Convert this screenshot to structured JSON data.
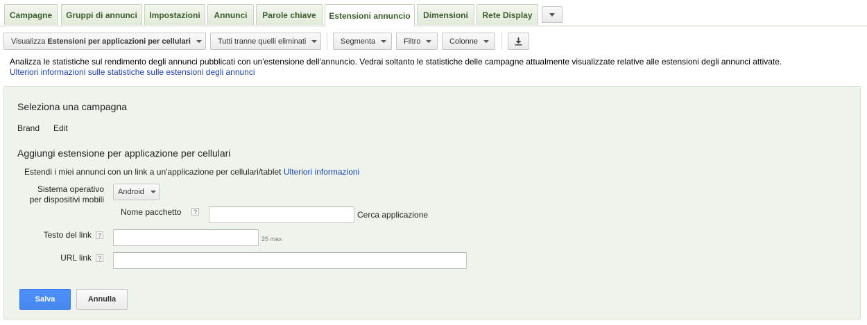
{
  "tabs": [
    {
      "label": "Campagne"
    },
    {
      "label": "Gruppi di annunci"
    },
    {
      "label": "Impostazioni"
    },
    {
      "label": "Annunci"
    },
    {
      "label": "Parole chiave"
    },
    {
      "label": "Estensioni annuncio",
      "active": true
    },
    {
      "label": "Dimensioni"
    },
    {
      "label": "Rete Display"
    }
  ],
  "toolbar": {
    "view_prefix": "Visualizza",
    "view_value": "Estensioni per applicazioni per cellulari",
    "status_filter": "Tutti tranne quelli eliminati",
    "segment": "Segmenta",
    "filter": "Filtro",
    "columns": "Colonne"
  },
  "info": {
    "text": "Analizza le statistiche sul rendimento degli annunci pubblicati con un'estensione dell'annuncio. Vedrai soltanto le statistiche delle campagne attualmente visualizzate relative alle estensioni degli annunci attivate.",
    "link": "Ulteriori informazioni sulle statistiche sulle estensioni degli annunci"
  },
  "panel": {
    "select_campaign_title": "Seleziona una campagna",
    "campaign_name": "Brand",
    "edit_link": "Edit",
    "add_title": "Aggiungi estensione per applicazione per cellulari",
    "description": "Estendi i miei annunci con un link a un'applicazione per cellulari/tablet",
    "more_info_link": "Ulteriori informazioni",
    "os_label_line1": "Sistema operativo",
    "os_label_line2": "per dispositivi mobili",
    "os_value": "Android",
    "package_label": "Nome pacchetto",
    "package_value": "",
    "search_app_link": "Cerca applicazione",
    "link_text_label": "Testo del link",
    "link_text_value": "",
    "link_text_max": "25 max",
    "link_url_label": "URL link",
    "link_url_value": "",
    "help_mark": "?",
    "save_button": "Salva",
    "cancel_button": "Annulla"
  },
  "icons": {
    "more_tabs": "chevron-down-icon",
    "download": "download-icon",
    "help": "help-icon"
  }
}
